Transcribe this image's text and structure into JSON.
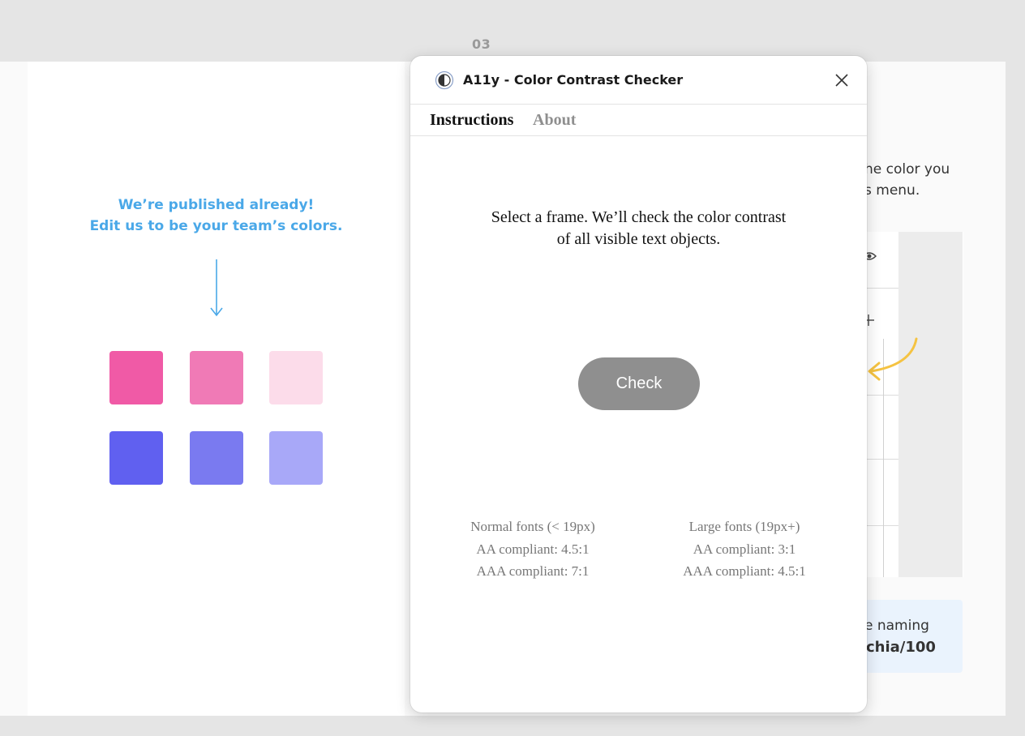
{
  "canvas": {
    "frame_label": "03",
    "left_caption_line1": "We’re published already!",
    "left_caption_line2": "Edit us to be your team’s colors.",
    "swatches": [
      "#f05aa6",
      "#f07ab6",
      "#fcdcea",
      "#6060f0",
      "#7a7af0",
      "#a8a8f8"
    ],
    "right_text_line1": "he color you",
    "right_text_line2": "s menu.",
    "info_line1": "e naming",
    "info_line2": "chia/100",
    "accent_colors": {
      "caption": "#4aa8e8",
      "arrow": "#f5c342"
    }
  },
  "plugin": {
    "title": "A11y - Color Contrast Checker",
    "icons": {
      "app": "contrast-icon",
      "close": "close-icon"
    },
    "tabs": [
      {
        "label": "Instructions",
        "active": true
      },
      {
        "label": "About",
        "active": false
      }
    ],
    "instructions_line1": "Select a frame. We’ll check the color contrast",
    "instructions_line2": "of all visible text objects.",
    "check_label": "Check",
    "normal": {
      "heading": "Normal fonts (< 19px)",
      "aa": "AA compliant: 4.5:1",
      "aaa": "AAA compliant: 7:1"
    },
    "large": {
      "heading": "Large fonts (19px+)",
      "aa": "AA compliant: 3:1",
      "aaa": "AAA compliant: 4.5:1"
    }
  }
}
